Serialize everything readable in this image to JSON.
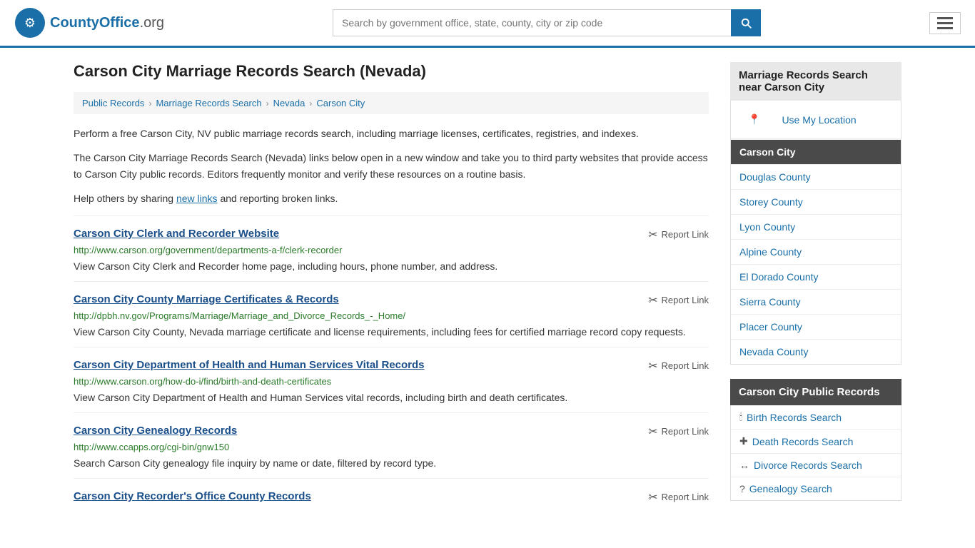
{
  "header": {
    "logo_text": "CountyOffice",
    "logo_suffix": ".org",
    "search_placeholder": "Search by government office, state, county, city or zip code",
    "menu_label": "Menu"
  },
  "page": {
    "title": "Carson City Marriage Records Search (Nevada)"
  },
  "breadcrumb": {
    "items": [
      {
        "label": "Public Records",
        "href": "#"
      },
      {
        "label": "Marriage Records Search",
        "href": "#"
      },
      {
        "label": "Nevada",
        "href": "#"
      },
      {
        "label": "Carson City",
        "href": "#"
      }
    ]
  },
  "description": {
    "para1": "Perform a free Carson City, NV public marriage records search, including marriage licenses, certificates, registries, and indexes.",
    "para2": "The Carson City Marriage Records Search (Nevada) links below open in a new window and take you to third party websites that provide access to Carson City public records. Editors frequently monitor and verify these resources on a routine basis.",
    "para3_prefix": "Help others by sharing ",
    "para3_link": "new links",
    "para3_suffix": " and reporting broken links."
  },
  "records": [
    {
      "title": "Carson City Clerk and Recorder Website",
      "url": "http://www.carson.org/government/departments-a-f/clerk-recorder",
      "desc": "View Carson City Clerk and Recorder home page, including hours, phone number, and address.",
      "report_label": "Report Link"
    },
    {
      "title": "Carson City County Marriage Certificates & Records",
      "url": "http://dpbh.nv.gov/Programs/Marriage/Marriage_and_Divorce_Records_-_Home/",
      "desc": "View Carson City County, Nevada marriage certificate and license requirements, including fees for certified marriage record copy requests.",
      "report_label": "Report Link"
    },
    {
      "title": "Carson City Department of Health and Human Services Vital Records",
      "url": "http://www.carson.org/how-do-i/find/birth-and-death-certificates",
      "desc": "View Carson City Department of Health and Human Services vital records, including birth and death certificates.",
      "report_label": "Report Link"
    },
    {
      "title": "Carson City Genealogy Records",
      "url": "http://www.ccapps.org/cgi-bin/gnw150",
      "desc": "Search Carson City genealogy file inquiry by name or date, filtered by record type.",
      "report_label": "Report Link"
    },
    {
      "title": "Carson City Recorder's Office County Records",
      "url": "",
      "desc": "",
      "report_label": "Report Link"
    }
  ],
  "sidebar": {
    "nearby_title": "Marriage Records Search near Carson City",
    "use_location": "Use My Location",
    "nearby_locations": [
      {
        "label": "Carson City",
        "active": true
      },
      {
        "label": "Douglas County",
        "active": false
      },
      {
        "label": "Storey County",
        "active": false
      },
      {
        "label": "Lyon County",
        "active": false
      },
      {
        "label": "Alpine County",
        "active": false
      },
      {
        "label": "El Dorado County",
        "active": false
      },
      {
        "label": "Sierra County",
        "active": false
      },
      {
        "label": "Placer County",
        "active": false
      },
      {
        "label": "Nevada County",
        "active": false
      }
    ],
    "public_records_title": "Carson City Public Records",
    "public_records": [
      {
        "label": "Birth Records Search",
        "icon": "🕯"
      },
      {
        "label": "Death Records Search",
        "icon": "✚"
      },
      {
        "label": "Divorce Records Search",
        "icon": "↔"
      },
      {
        "label": "Genealogy Search",
        "icon": "?"
      }
    ]
  }
}
